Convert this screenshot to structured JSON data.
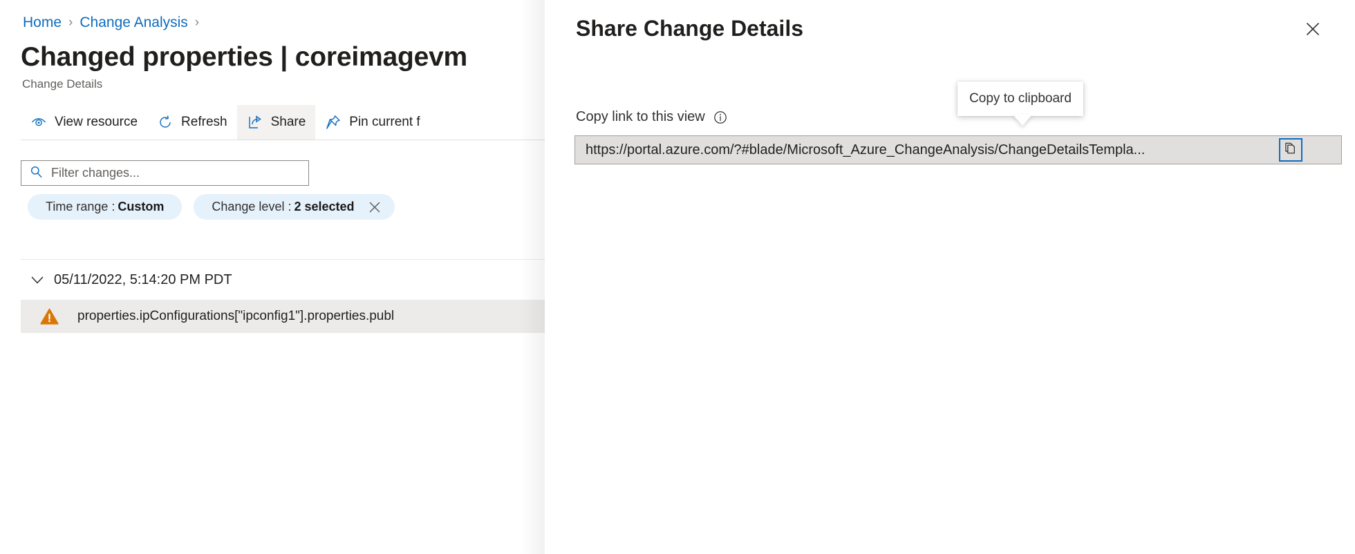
{
  "breadcrumb": {
    "items": [
      {
        "label": "Home"
      },
      {
        "label": "Change Analysis"
      }
    ],
    "separator": "›"
  },
  "header": {
    "title": "Changed properties | coreimagevm",
    "subtitle": "Change Details"
  },
  "toolbar": {
    "items": [
      {
        "label": "View resource",
        "icon": "eye-icon",
        "active": false
      },
      {
        "label": "Refresh",
        "icon": "refresh-icon",
        "active": false
      },
      {
        "label": "Share",
        "icon": "share-icon",
        "active": true
      },
      {
        "label": "Pin current f",
        "icon": "pin-icon",
        "active": false
      }
    ]
  },
  "filter": {
    "placeholder": "Filter changes...",
    "icon": "search-icon"
  },
  "chips": [
    {
      "key": "Time range :",
      "value": "Custom",
      "removable": false
    },
    {
      "key": "Change level :",
      "value": "2 selected",
      "removable": true
    }
  ],
  "changes": {
    "group": {
      "timestamp": "05/11/2022, 5:14:20 PM PDT",
      "expanded": true,
      "chevron": "chevron-down-icon"
    },
    "rows": [
      {
        "severity": "warning",
        "icon": "warning-triangle-icon",
        "text": "properties.ipConfigurations[\"ipconfig1\"].properties.publ"
      }
    ]
  },
  "panel": {
    "title": "Share Change Details",
    "close_icon": "close-icon",
    "field_label": "Copy link to this view",
    "info_icon": "info-circle-icon",
    "url_value": "https://portal.azure.com/?#blade/Microsoft_Azure_ChangeAnalysis/ChangeDetailsTempla...",
    "copy_icon": "copy-icon",
    "tooltip": "Copy to clipboard"
  },
  "colors": {
    "link": "#0f6cbd",
    "accent": "#0f6cbd",
    "warning": "#d97706",
    "chip_bg": "#e5f1fb",
    "row_bg": "#edebe9",
    "field_bg": "#e1dfdd"
  }
}
